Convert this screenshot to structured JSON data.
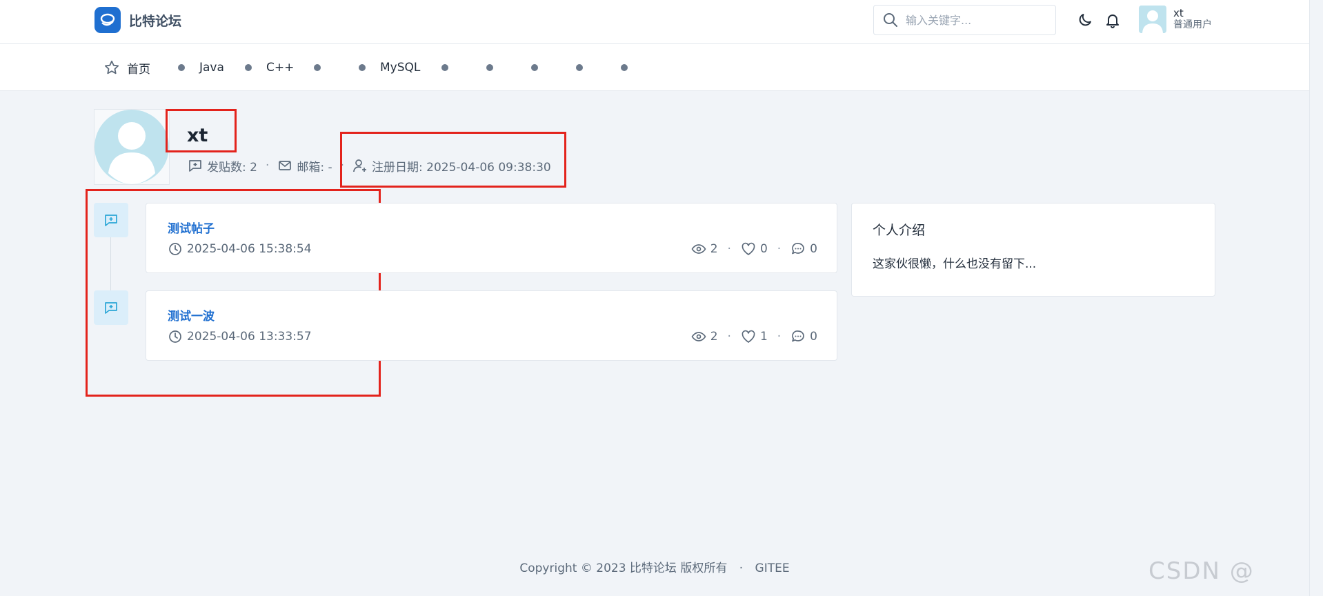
{
  "header": {
    "brand_name": "比特论坛",
    "search_placeholder": "输入关键字...",
    "user_name": "xt",
    "user_role": "普通用户"
  },
  "nav": {
    "items": [
      {
        "label": "首页",
        "icon": "star-icon"
      },
      {
        "label": "Java",
        "icon": "dot"
      },
      {
        "label": "C++",
        "icon": "dot"
      },
      {
        "label": "",
        "icon": "dot"
      },
      {
        "label": "MySQL",
        "icon": "dot"
      },
      {
        "label": "",
        "icon": "dot"
      },
      {
        "label": "",
        "icon": "dot"
      },
      {
        "label": "",
        "icon": "dot"
      },
      {
        "label": "",
        "icon": "dot"
      },
      {
        "label": "",
        "icon": "dot"
      }
    ]
  },
  "profile": {
    "name": "xt",
    "post_count_label": "发贴数: 2",
    "email_label": "邮箱: -",
    "register_label": "注册日期: 2025-04-06 09:38:30"
  },
  "posts": [
    {
      "title": "测试帖子",
      "time": "2025-04-06 15:38:54",
      "views": "2",
      "likes": "0",
      "comments": "0"
    },
    {
      "title": "测试一波",
      "time": "2025-04-06 13:33:57",
      "views": "2",
      "likes": "1",
      "comments": "0"
    }
  ],
  "intro": {
    "title": "个人介绍",
    "text": "这家伙很懒，什么也没有留下..."
  },
  "footer": {
    "copyright": "Copyright © 2023 比特论坛 版权所有",
    "separator": "·",
    "link": "GITEE"
  },
  "watermark": "CSDN @",
  "colors": {
    "accent": "#1f6fd0",
    "annotation_red": "#e3231c",
    "background": "#f1f4f8"
  }
}
